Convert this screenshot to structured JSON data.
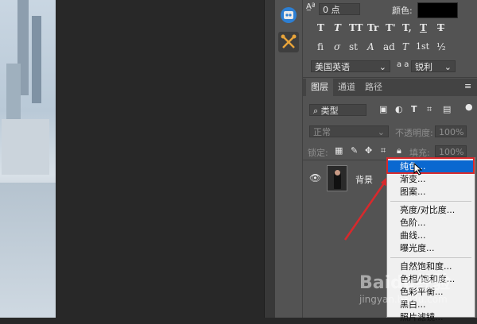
{
  "character": {
    "tracking_value": "0 点",
    "color_label": "颜色:",
    "color_swatch": "#000000",
    "type_style_glyphs": [
      "T",
      "T",
      "TT",
      "Tr",
      "T'",
      "T,",
      "T",
      "T"
    ],
    "opentype_glyphs": [
      "fi",
      "σ",
      "st",
      "A",
      "ad",
      "T",
      "1st",
      "½"
    ],
    "language": "美国英语",
    "aa_label": "a a",
    "antialias": "锐利"
  },
  "layers": {
    "tabs": [
      "图层",
      "通道",
      "路径"
    ],
    "filter_kind": "类型",
    "blend_mode": "正常",
    "opacity_label": "不透明度:",
    "opacity_value": "100%",
    "lock_label": "锁定:",
    "fill_label": "填充:",
    "fill_value": "100%",
    "layer_name": "背景"
  },
  "context_menu": {
    "items": [
      {
        "label": "纯色...",
        "highlighted": true
      },
      {
        "label": "渐变..."
      },
      {
        "label": "图案..."
      },
      {
        "label": "亮度/对比度..."
      },
      {
        "label": "色阶..."
      },
      {
        "label": "曲线..."
      },
      {
        "label": "曝光度..."
      },
      {
        "label": "自然饱和度..."
      },
      {
        "label": "色相/饱和度..."
      },
      {
        "label": "色彩平衡..."
      },
      {
        "label": "黑白..."
      },
      {
        "label": "照片滤镜..."
      }
    ]
  },
  "watermark": {
    "text": "Baidu经验",
    "sub": "jingyan.baidu.com"
  },
  "colors": {
    "panel_bg": "#535353",
    "menu_highlight": "#0a68d0",
    "annotation_red": "#d8292c"
  }
}
